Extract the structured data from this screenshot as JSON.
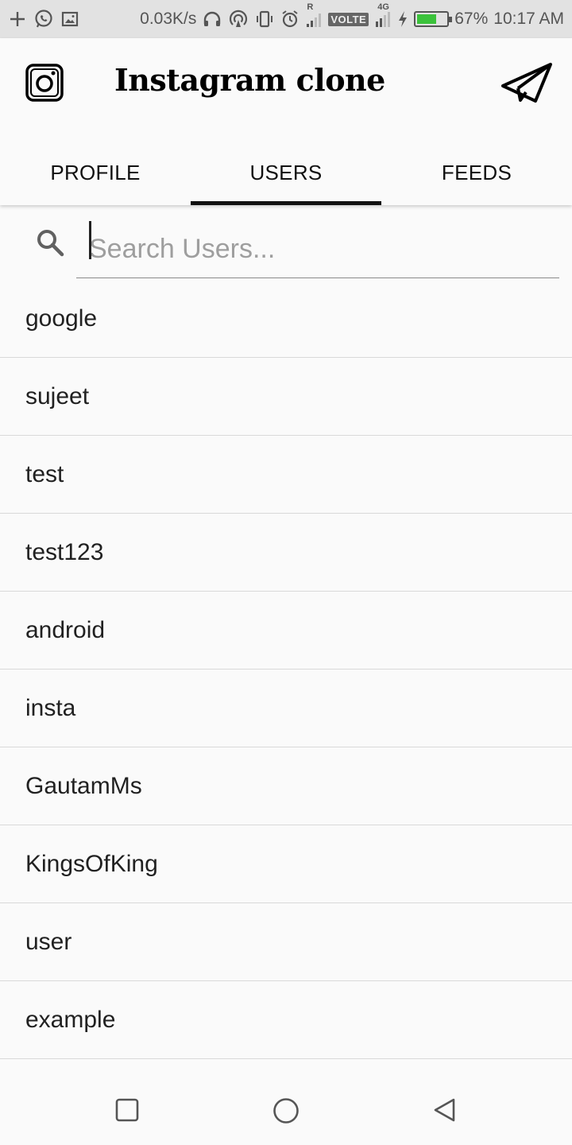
{
  "status_bar": {
    "net_speed": "0.03K/s",
    "volte": "VOLTE",
    "battery_pct": "67%",
    "battery_level": 0.67,
    "time": "10:17 AM",
    "roaming_mark": "R",
    "net_type": "4G",
    "icons": [
      "plus-icon",
      "whatsapp-icon",
      "image-icon",
      "headphones-icon",
      "hotspot-icon",
      "vibrate-icon",
      "alarm-icon",
      "signal-icon",
      "charging-icon",
      "battery-icon"
    ]
  },
  "app_bar": {
    "title": "Instagram clone",
    "logo_icon": "instagram-logo-icon",
    "action_icon": "send-icon"
  },
  "tabs": [
    {
      "label": "PROFILE",
      "active": false
    },
    {
      "label": "USERS",
      "active": true
    },
    {
      "label": "FEEDS",
      "active": false
    }
  ],
  "search": {
    "placeholder": "Search Users...",
    "value": ""
  },
  "users": [
    "google",
    "sujeet",
    "test",
    "test123",
    "android",
    "insta",
    "GautamMs",
    "KingsOfKing",
    "user",
    "example"
  ],
  "nav_bar": {
    "icons": [
      "recents-square-icon",
      "home-circle-icon",
      "back-triangle-icon"
    ]
  },
  "colors": {
    "background": "#fafafa",
    "status_bar": "#e2e2e2",
    "battery": "#3bc23b",
    "divider": "#d9d9d9",
    "tab_indicator": "#111111"
  }
}
